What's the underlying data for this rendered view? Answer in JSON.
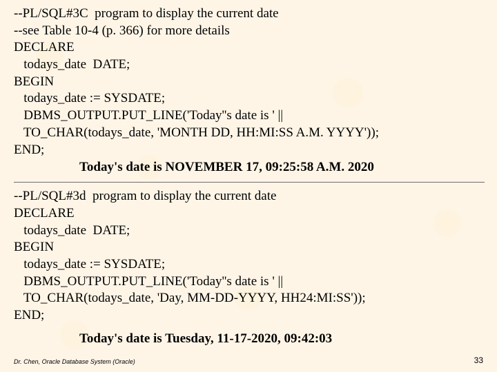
{
  "block1": {
    "l1": "--PL/SQL#3C  program to display the current date",
    "l2": "--see Table 10-4 (p. 366) for more details",
    "l3": "DECLARE",
    "l4": "   todays_date  DATE;",
    "l5": "BEGIN",
    "l6": "   todays_date := SYSDATE;",
    "l7": "   DBMS_OUTPUT.PUT_LINE('Today''s date is ' ||",
    "l8": "   TO_CHAR(todays_date, 'MONTH DD, HH:MI:SS A.M. YYYY'));",
    "l9": "END;",
    "output": "Today's date is NOVEMBER 17,  09:25:58  A.M. 2020"
  },
  "block2": {
    "l1": "--PL/SQL#3d  program to display the current date",
    "l2": "DECLARE",
    "l3": "   todays_date  DATE;",
    "l4": "BEGIN",
    "l5": "   todays_date := SYSDATE;",
    "l6": "   DBMS_OUTPUT.PUT_LINE('Today''s date is ' ||",
    "l7": "   TO_CHAR(todays_date, 'Day, MM-DD-YYYY, HH24:MI:SS'));",
    "l8": "END;",
    "output": "Today's date is Tuesday, 11-17-2020, 09:42:03"
  },
  "footer": {
    "left": "Dr. Chen, Oracle Database System (Oracle)",
    "right": "33"
  }
}
